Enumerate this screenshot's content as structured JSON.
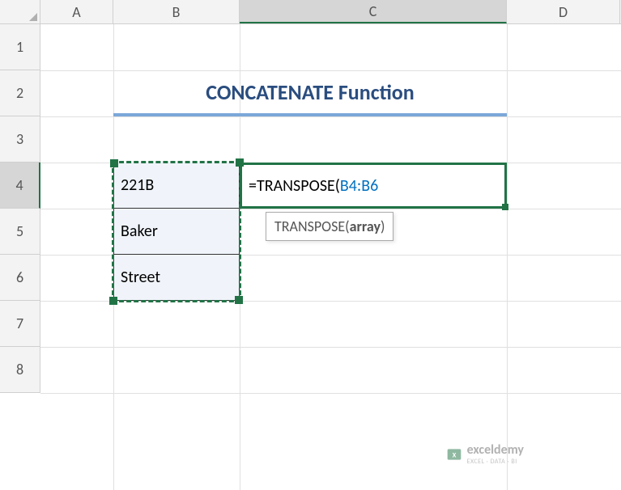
{
  "columns": {
    "a": "A",
    "b": "B",
    "c": "C",
    "d": "D"
  },
  "rows": {
    "r1": "1",
    "r2": "2",
    "r3": "3",
    "r4": "4",
    "r5": "5",
    "r6": "6",
    "r7": "7",
    "r8": "8"
  },
  "cells": {
    "title": "CONCATENATE Function",
    "b4": "221B",
    "b5": "Baker",
    "b6": "Street"
  },
  "formula": {
    "prefix": "=TRANSPOSE(",
    "reference": "B4:B6"
  },
  "tooltip": {
    "func": "TRANSPOSE(",
    "arg": "array",
    "suffix": ")"
  },
  "watermark": {
    "name": "exceldemy",
    "tagline": "EXCEL · DATA · BI"
  }
}
